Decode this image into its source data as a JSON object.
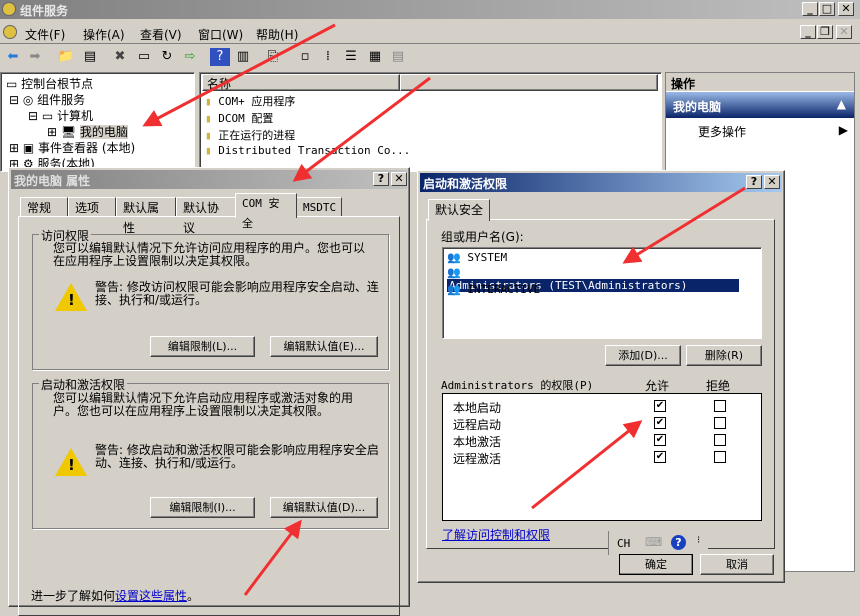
{
  "window": {
    "title": "组件服务",
    "menu": [
      "文件(F)",
      "操作(A)",
      "查看(V)",
      "窗口(W)",
      "帮助(H)"
    ]
  },
  "tree": {
    "items": [
      "控制台根节点",
      "组件服务",
      "计算机",
      "我的电脑",
      "事件查看器 (本地)",
      "服务(本地)"
    ]
  },
  "list": {
    "column": "名称",
    "items": [
      "COM+ 应用程序",
      "DCOM 配置",
      "正在运行的进程",
      "Distributed Transaction Co..."
    ]
  },
  "actions": {
    "header": "操作",
    "section": "我的电脑",
    "more": "更多操作"
  },
  "props": {
    "title": "我的电脑 属性",
    "tabs": [
      "常规",
      "选项",
      "默认属性",
      "默认协议",
      "COM 安全",
      "MSDTC"
    ],
    "access": {
      "legend": "访问权限",
      "desc": "您可以编辑默认情况下允许访问应用程序的用户。您也可以在应用程序上设置限制以决定其权限。",
      "warning": "警告: 修改访问权限可能会影响应用程序安全启动、连接、执行和/或运行。",
      "edit_limits": "编辑限制(L)...",
      "edit_default": "编辑默认值(E)..."
    },
    "launch": {
      "legend": "启动和激活权限",
      "desc": "您可以编辑默认情况下允许启动应用程序或激活对象的用户。您也可以在应用程序上设置限制以决定其权限。",
      "warning": "警告: 修改启动和激活权限可能会影响应用程序安全启动、连接、执行和/或运行。",
      "edit_limits": "编辑限制(I)...",
      "edit_default": "编辑默认值(D)..."
    },
    "footer_prefix": "进一步了解如何",
    "footer_link": "设置这些属性",
    "footer_suffix": "。"
  },
  "perm": {
    "title": "启动和激活权限",
    "tab": "默认安全",
    "group_label": "组或用户名(G):",
    "users": [
      "SYSTEM",
      "Administrators (TEST\\Administrators)",
      "INTERACTIVE"
    ],
    "selected_user": 1,
    "add": "添加(D)...",
    "remove": "删除(R)",
    "perm_label": "Administrators 的权限(P)",
    "allow": "允许",
    "deny": "拒绝",
    "permissions": [
      {
        "name": "本地启动",
        "allow": true,
        "deny": false
      },
      {
        "name": "远程启动",
        "allow": true,
        "deny": false
      },
      {
        "name": "本地激活",
        "allow": true,
        "deny": false
      },
      {
        "name": "远程激活",
        "allow": true,
        "deny": false
      }
    ],
    "link": "了解访问控制和权限",
    "ime": "CH",
    "ok": "确定",
    "cancel": "取消"
  },
  "colors": {
    "selection": "#0a246a",
    "annotation_arrow": "#f03030"
  }
}
